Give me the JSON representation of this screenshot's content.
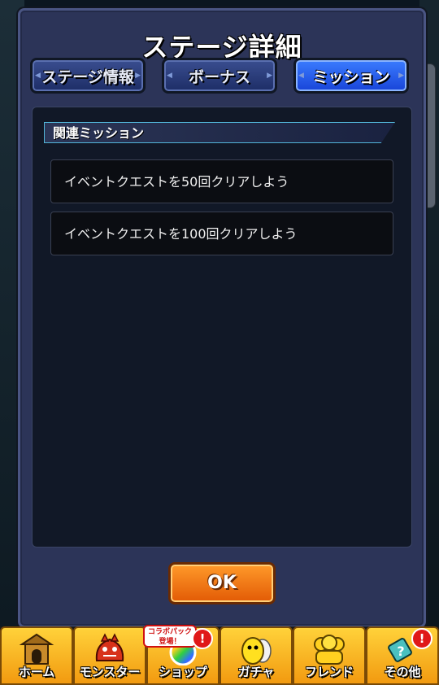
{
  "dialog": {
    "title": "ステージ詳細",
    "tabs": [
      {
        "label": "ステージ情報",
        "active": false
      },
      {
        "label": "ボーナス",
        "active": false
      },
      {
        "label": "ミッション",
        "active": true
      }
    ],
    "section_title": "関連ミッション",
    "missions": [
      "イベントクエストを50回クリアしよう",
      "イベントクエストを100回クリアしよう"
    ],
    "ok_label": "OK"
  },
  "bottom_nav": {
    "items": [
      {
        "label": "ホーム",
        "icon": "home-gate-icon"
      },
      {
        "label": "モンスター",
        "icon": "monster-icon"
      },
      {
        "label": "ショップ",
        "icon": "rainbow-orb-icon",
        "promo_line1": "コラボパック",
        "promo_line2": "登場！",
        "badge": "!"
      },
      {
        "label": "ガチャ",
        "icon": "gacha-egg-icon"
      },
      {
        "label": "フレンド",
        "icon": "friends-icon"
      },
      {
        "label": "その他",
        "icon": "other-menu-icon",
        "badge": "!"
      }
    ]
  },
  "colors": {
    "dialog_bg": "#2c3458",
    "tab_active": "#1f5cff",
    "ok_button": "#f07a12",
    "nav_bg": "#f5b020"
  }
}
